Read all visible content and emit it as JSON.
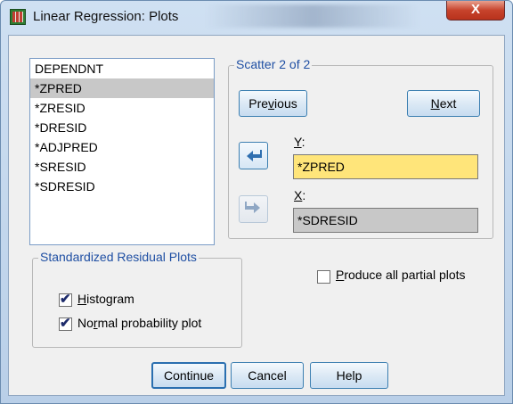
{
  "window": {
    "title": "Linear Regression: Plots",
    "close_glyph": "X"
  },
  "variables": {
    "items": [
      {
        "label": "DEPENDNT",
        "selected": false
      },
      {
        "label": "*ZPRED",
        "selected": true
      },
      {
        "label": "*ZRESID",
        "selected": false
      },
      {
        "label": "*DRESID",
        "selected": false
      },
      {
        "label": "*ADJPRED",
        "selected": false
      },
      {
        "label": "*SRESID",
        "selected": false
      },
      {
        "label": "*SDRESID",
        "selected": false
      }
    ]
  },
  "scatter": {
    "legend": "Scatter 2 of 2",
    "previous_label": {
      "pre": "Pre",
      "key": "v",
      "post": "ious"
    },
    "next_label": {
      "pre": "",
      "key": "N",
      "post": "ext"
    },
    "y_label_key": "Y",
    "y_label_rest": ":",
    "y_value": "*ZPRED",
    "x_label_key": "X",
    "x_label_rest": ":",
    "x_value": "*SDRESID"
  },
  "standardized_residual_plots": {
    "legend": "Standardized Residual Plots",
    "histogram": {
      "checked": true,
      "pre": "",
      "key": "H",
      "post": "istogram"
    },
    "normal_probability": {
      "checked": true,
      "pre": "No",
      "key": "r",
      "post": "mal probability plot"
    }
  },
  "partial_plots": {
    "checked": false,
    "pre": "",
    "key": "P",
    "post": "roduce all partial plots"
  },
  "footer": {
    "continue_label": "Continue",
    "cancel_label": "Cancel",
    "help_label": "Help"
  },
  "colors": {
    "target_highlight": "#ffe57a",
    "selection": "#c8c8c8",
    "legend_text": "#1f4fa3",
    "arrow_active": "#2f6fb0",
    "arrow_disabled": "#8fa7c4"
  }
}
